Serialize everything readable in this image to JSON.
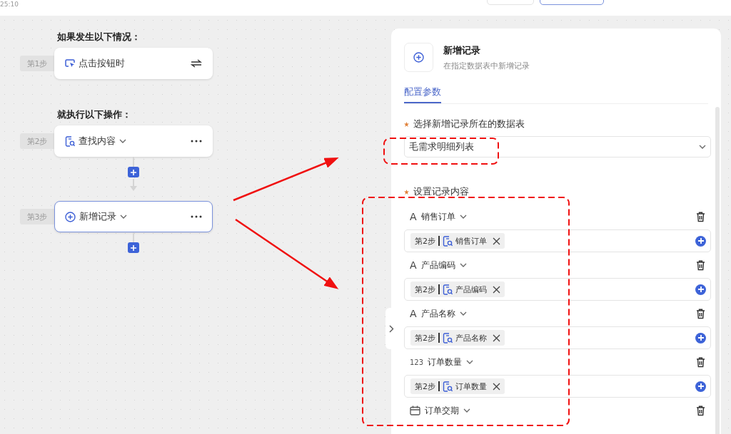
{
  "status_time": "25:10",
  "flow": {
    "trigger_heading": "如果发生以下情况：",
    "trigger": {
      "step_label": "第1步",
      "kind": "click",
      "label": "点击按钮时"
    },
    "action_heading": "就执行以下操作：",
    "actions": [
      {
        "step_label": "第2步",
        "kind": "find",
        "label": "查找内容",
        "selected": false
      },
      {
        "step_label": "第3步",
        "kind": "add",
        "label": "新增记录",
        "selected": true
      }
    ]
  },
  "panel": {
    "title": "新增记录",
    "subtitle": "在指定数据表中新增记录",
    "tabs": [
      {
        "label": "配置参数",
        "selected": true
      }
    ],
    "table_field": {
      "label": "选择新增记录所在的数据表",
      "required": true,
      "value": "毛需求明细列表"
    },
    "content_label": {
      "label": "设置记录内容",
      "required": true
    },
    "fields": [
      {
        "kind": "text",
        "type_label": "A",
        "name": "销售订单",
        "token": {
          "step": "第2步",
          "name": "销售订单"
        }
      },
      {
        "kind": "text",
        "type_label": "A",
        "name": "产品编码",
        "token": {
          "step": "第2步",
          "name": "产品编码"
        }
      },
      {
        "kind": "text",
        "type_label": "A",
        "name": "产品名称",
        "token": {
          "step": "第2步",
          "name": "产品名称"
        }
      },
      {
        "kind": "number",
        "type_label": "123",
        "name": "订单数量",
        "token": {
          "step": "第2步",
          "name": "订单数量"
        }
      },
      {
        "kind": "date",
        "name": "订单交期"
      }
    ]
  }
}
